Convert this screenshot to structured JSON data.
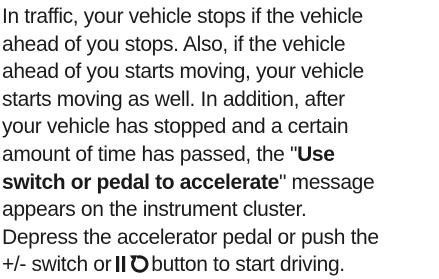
{
  "paragraph": {
    "line1": "In traffic, your vehicle stops if the vehicle",
    "line2": "ahead of you stops. Also, if the vehicle",
    "line3": "ahead of you starts moving, your vehicle",
    "line4": "starts moving as well. In addition, after",
    "line5": "your vehicle has stopped and a certain",
    "line6": "amount of time has passed, the \"",
    "line6_bold": "Use",
    "line7_bold": "switch or pedal to accelerate",
    "line7_rest": "\" message",
    "line8": "appears on the instrument cluster.",
    "line9": "Depress the accelerator pedal or push the",
    "line10_pre": "+/- switch or",
    "line10_post": "button to start driving."
  },
  "icons": {
    "resume": "pause-resume-icon"
  }
}
